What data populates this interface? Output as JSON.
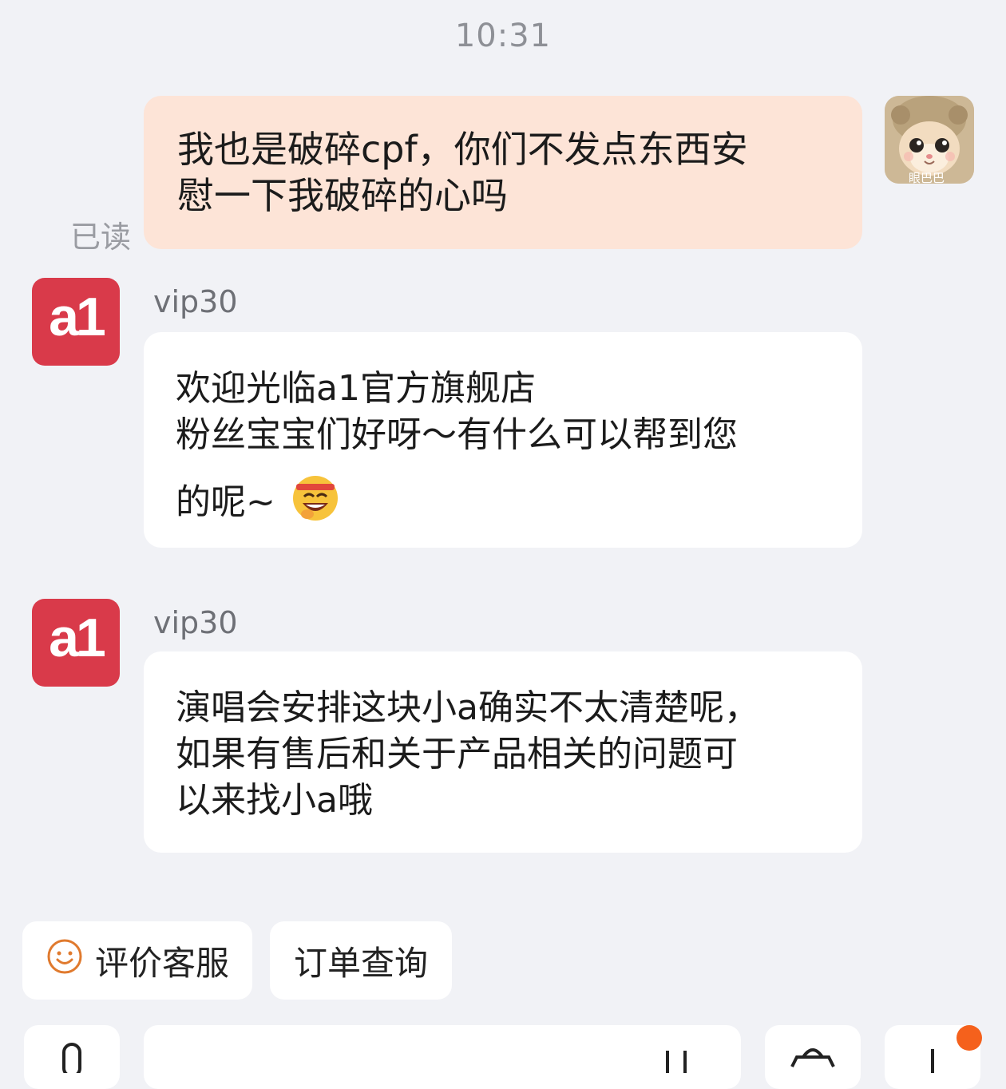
{
  "time": "10:31",
  "outgoing": {
    "lines": [
      "我也是破碎cpf，你们不发点东西安",
      "慰一下我破碎的心吗"
    ],
    "read_status": "已读",
    "avatar_caption": "眼巴巴"
  },
  "shop": {
    "avatar_text": "a1",
    "avatar_color": "#d93a4a"
  },
  "incoming": [
    {
      "sender": "vip30",
      "lines": [
        "欢迎光临a1官方旗舰店",
        "粉丝宝宝们好呀～有什么可以帮到您",
        "的呢~"
      ],
      "emoji": "grinning-face-emoji"
    },
    {
      "sender": "vip30",
      "lines": [
        "演唱会安排这块小a确实不太清楚呢，",
        "如果有售后和关于产品相关的问题可",
        "以来找小a哦"
      ]
    }
  ],
  "quick_actions": [
    {
      "label": "评价客服",
      "icon": "smile-icon"
    },
    {
      "label": "订单查询"
    }
  ],
  "colors": {
    "background": "#f1f2f6",
    "outgoing_bubble": "#fde4d7",
    "incoming_bubble": "#ffffff",
    "notification_dot": "#f5611c",
    "smile_icon": "#e07a2e"
  }
}
